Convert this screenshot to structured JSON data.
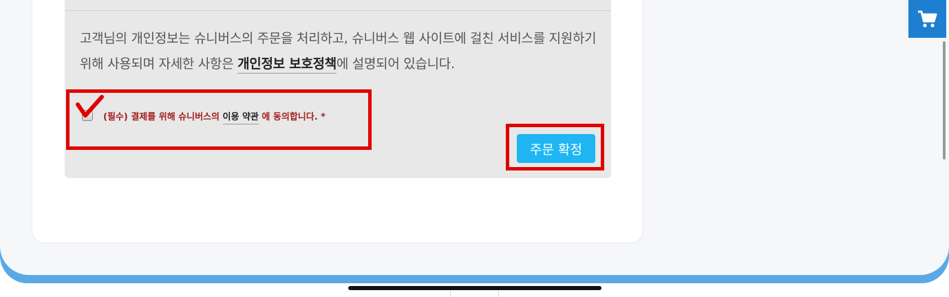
{
  "privacy_notice": {
    "text_before_link": "고객님의 개인정보는 슈니버스의 주문을 처리하고, 슈니버스 웹 사이트에 걸친 서비스를 지원하기 위해 사용되며 자세한 사항은 ",
    "link_label": "개인정보 보호정책",
    "text_after_link": "에 설명되어 있습니다."
  },
  "consent": {
    "prefix": "(필수) 결제를 위해 슈니버스의 ",
    "terms_link": "이용 약관",
    "suffix": " 에 동의합니다. *",
    "checked": false
  },
  "confirm_button_label": "주문 확정",
  "colors": {
    "highlight_red": "#e00000",
    "button_blue": "#1fb6f3",
    "cart_blue": "#1e7fd1",
    "required_text": "#a41d1d"
  },
  "icons": {
    "cart": "cart-icon",
    "annotation": "red-check-annotation-icon"
  }
}
